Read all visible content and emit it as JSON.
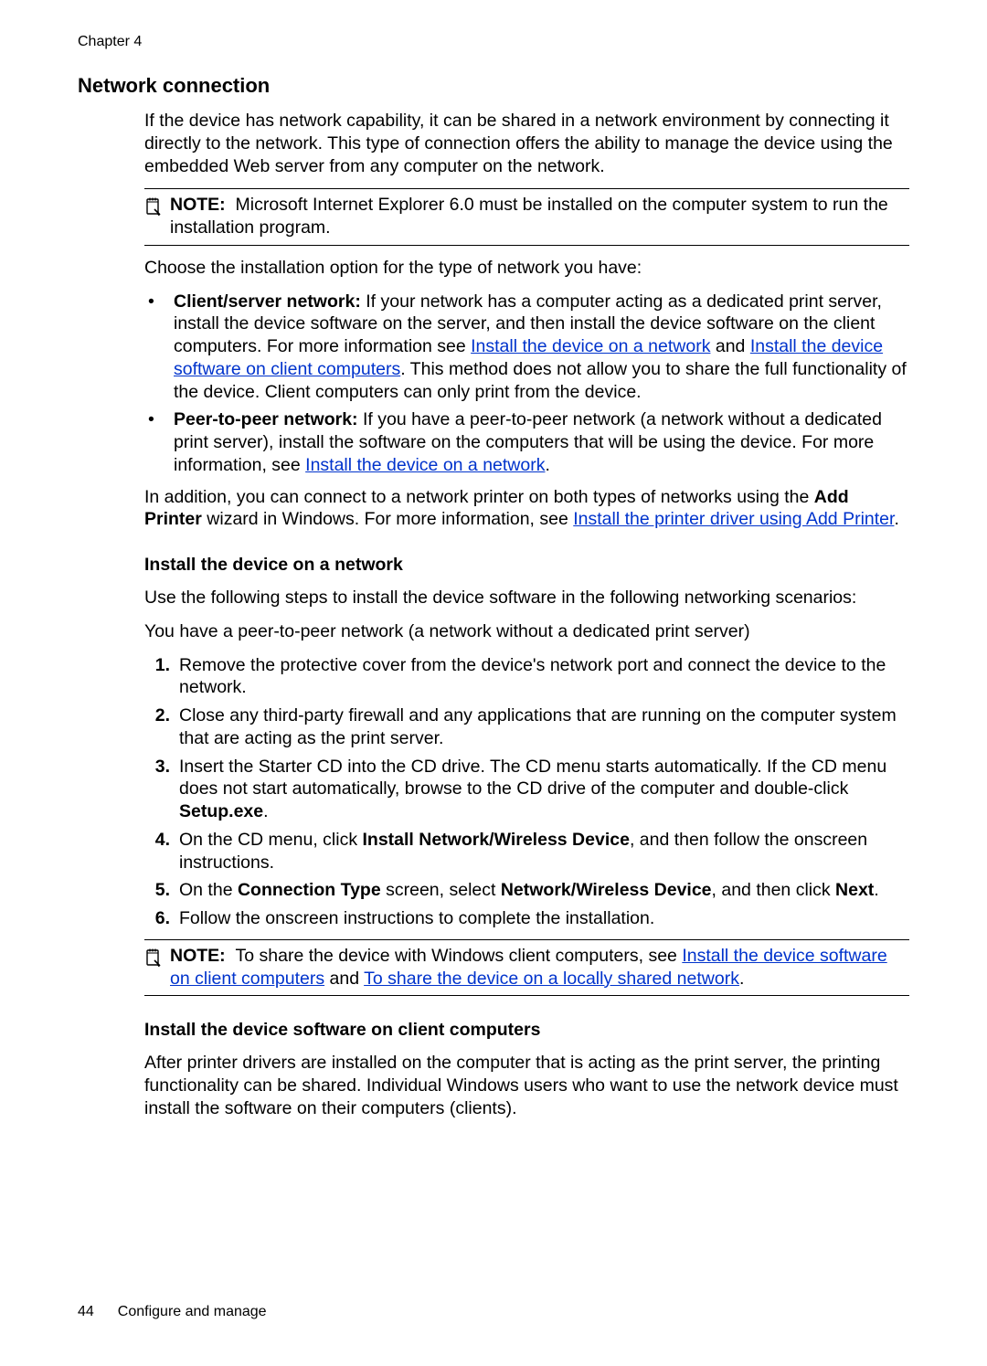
{
  "chapter": "Chapter 4",
  "h1": "Network connection",
  "intro": "If the device has network capability, it can be shared in a network environment by connecting it directly to the network. This type of connection offers the ability to manage the device using the embedded Web server from any computer on the network.",
  "note1_label": "NOTE:",
  "note1_body": "Microsoft Internet Explorer 6.0 must be installed on the computer system to run the installation program.",
  "choose": "Choose the installation option for the type of network you have:",
  "bullet1_label": "Client/server network:",
  "bullet1_a": " If your network has a computer acting as a dedicated print server, install the device software on the server, and then install the device software on the client computers. For more information see ",
  "bullet1_link1": "Install the device on a network",
  "bullet1_b": " and ",
  "bullet1_link2": "Install the device software on client computers",
  "bullet1_c": ". This method does not allow you to share the full functionality of the device. Client computers can only print from the device.",
  "bullet2_label": "Peer-to-peer network:",
  "bullet2_a": " If you have a peer-to-peer network (a network without a dedicated print server), install the software on the computers that will be using the device. For more information, see ",
  "bullet2_link": "Install the device on a network",
  "bullet2_b": ".",
  "addition_a": "In addition, you can connect to a network printer on both types of networks using the ",
  "addition_bold1": "Add Printer",
  "addition_b": " wizard in Windows. For more information, see ",
  "addition_link": "Install the printer driver using Add Printer",
  "addition_c": ".",
  "h2a": "Install the device on a network",
  "scenarios": "Use the following steps to install the device software in the following networking scenarios:",
  "yhave": "You have a peer-to-peer network (a network without a dedicated print server)",
  "steps": [
    {
      "n": "1.",
      "a": "Remove the protective cover from the device's network port and connect the device to the network."
    },
    {
      "n": "2.",
      "a": "Close any third-party firewall and any applications that are running on the computer system that are acting as the print server."
    },
    {
      "n": "3.",
      "a": "Insert the Starter CD into the CD drive. The CD menu starts automatically. If the CD menu does not start automatically, browse to the CD drive of the computer and double-click ",
      "b": "Setup.exe",
      "c": "."
    },
    {
      "n": "4.",
      "a": "On the CD menu, click ",
      "b": "Install Network/Wireless Device",
      "c": ", and then follow the onscreen instructions."
    },
    {
      "n": "5.",
      "a": "On the ",
      "b": "Connection Type",
      "c": " screen, select ",
      "d": "Network/Wireless Device",
      "e": ", and then click ",
      "f": "Next",
      "g": "."
    },
    {
      "n": "6.",
      "a": "Follow the onscreen instructions to complete the installation."
    }
  ],
  "note2_label": "NOTE:",
  "note2_a": "To share the device with Windows client computers, see ",
  "note2_link1": "Install the device software on client computers",
  "note2_b": " and ",
  "note2_link2": "To share the device on a locally shared network",
  "note2_c": ".",
  "h2b": "Install the device software on client computers",
  "after": "After printer drivers are installed on the computer that is acting as the print server, the printing functionality can be shared. Individual Windows users who want to use the network device must install the software on their computers (clients).",
  "footer_page": "44",
  "footer_title": "Configure and manage"
}
